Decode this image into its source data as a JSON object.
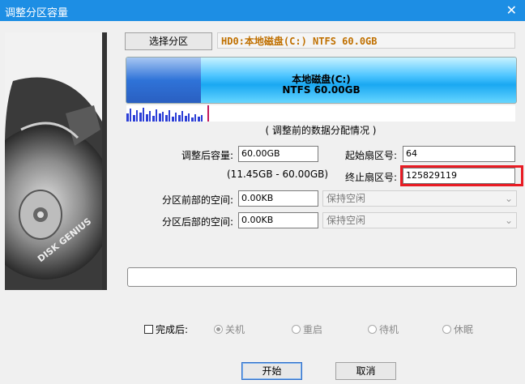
{
  "window": {
    "title": "调整分区容量",
    "close_glyph": "✕"
  },
  "left_panel": {
    "brand_text": "DISK GENIUS"
  },
  "select_partition_button": "选择分区",
  "partition_header": "HD0:本地磁盘(C:) NTFS 60.0GB",
  "partition_bar": {
    "line1": "本地磁盘(C:)",
    "line2": "NTFS 60.00GB",
    "used_fraction": 0.19
  },
  "distribution_caption": "( 调整前的数据分配情况 )",
  "form": {
    "size_label": "调整后容量:",
    "size_value": "60.00GB",
    "size_range": "(11.45GB - 60.00GB)",
    "start_sector_label": "起始扇区号:",
    "start_sector_value": "64",
    "end_sector_label": "终止扇区号:",
    "end_sector_value": "125829119",
    "before_space_label": "分区前部的空间:",
    "before_space_value": "0.00KB",
    "before_space_option": "保持空闲",
    "after_space_label": "分区后部的空间:",
    "after_space_value": "0.00KB",
    "after_space_option": "保持空闲"
  },
  "after_complete": {
    "label": "完成后:",
    "options": [
      {
        "label": "关机",
        "selected": true
      },
      {
        "label": "重启",
        "selected": false
      },
      {
        "label": "待机",
        "selected": false
      },
      {
        "label": "休眠",
        "selected": false
      }
    ]
  },
  "buttons": {
    "start": "开始",
    "cancel": "取消"
  },
  "colors": {
    "titlebar": "#1d8ee4",
    "highlight": "#e81b23",
    "header_text": "#c07000"
  }
}
